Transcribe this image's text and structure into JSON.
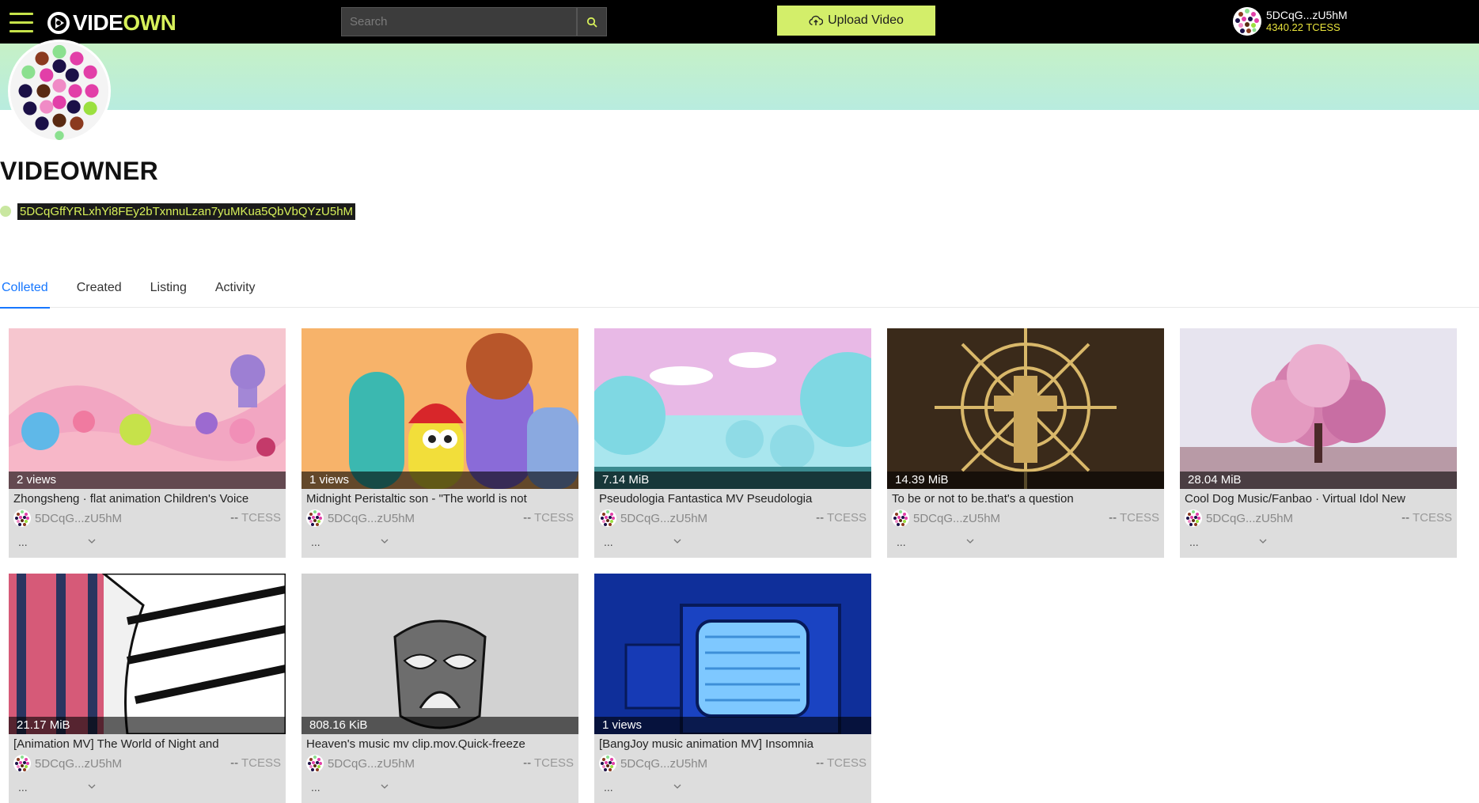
{
  "header": {
    "logo_prefix": "VIDE",
    "logo_suffix": "OWN",
    "search_placeholder": "Search",
    "upload_label": "Upload Video",
    "user": {
      "name": "5DCqG...zU5hM",
      "balance": "4340.22 TCESS"
    }
  },
  "profile": {
    "name": "VIDEOWNER",
    "address": "5DCqGffYRLxhYi8FEy2bTxnnuLzan7yuMKua5QbVbQYzU5hM"
  },
  "tabs": [
    {
      "label": "Colleted",
      "active": true
    },
    {
      "label": "Created",
      "active": false
    },
    {
      "label": "Listing",
      "active": false
    },
    {
      "label": "Activity",
      "active": false
    }
  ],
  "cards": [
    {
      "badge": "2 views",
      "title": "Zhongsheng · flat animation Children's Voice",
      "owner": "5DCqG...zU5hM",
      "price": "--",
      "currency": "TCESS",
      "more": "..."
    },
    {
      "badge": "1 views",
      "title": "Midnight Peristaltic son - \"The world is not",
      "owner": "5DCqG...zU5hM",
      "price": "--",
      "currency": "TCESS",
      "more": "..."
    },
    {
      "badge": "7.14 MiB",
      "title": "Pseudologia Fantastica MV Pseudologia",
      "owner": "5DCqG...zU5hM",
      "price": "--",
      "currency": "TCESS",
      "more": "..."
    },
    {
      "badge": "14.39 MiB",
      "title": "To be or not to be.that's a question",
      "owner": "5DCqG...zU5hM",
      "price": "--",
      "currency": "TCESS",
      "more": "..."
    },
    {
      "badge": "28.04 MiB",
      "title": "Cool Dog Music/Fanbao · Virtual Idol New",
      "owner": "5DCqG...zU5hM",
      "price": "--",
      "currency": "TCESS",
      "more": "..."
    },
    {
      "badge": "21.17 MiB",
      "title": "[Animation MV] The World of Night and",
      "owner": "5DCqG...zU5hM",
      "price": "--",
      "currency": "TCESS",
      "more": "..."
    },
    {
      "badge": "808.16 KiB",
      "title": "Heaven's music mv clip.mov.Quick-freeze",
      "owner": "5DCqG...zU5hM",
      "price": "--",
      "currency": "TCESS",
      "more": "..."
    },
    {
      "badge": "1 views",
      "title": "[BangJoy music animation MV] Insomnia",
      "owner": "5DCqG...zU5hM",
      "price": "--",
      "currency": "TCESS",
      "more": "..."
    }
  ]
}
